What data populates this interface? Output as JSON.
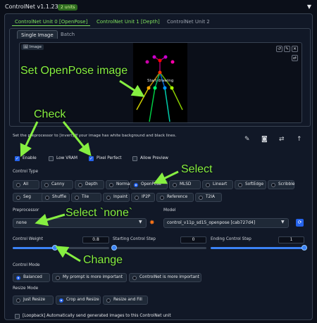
{
  "header": {
    "title": "ControlNet v1.1.233",
    "badge": "2 units",
    "collapse_icon": "triangle-down-icon"
  },
  "units_tabs": [
    "ControlNet Unit 0 [OpenPose]",
    "ControlNet Unit 1 [Depth]",
    "ControlNet Unit 2"
  ],
  "sub_tabs": [
    "Single Image",
    "Batch"
  ],
  "image": {
    "label": "Image",
    "overlay_text": "Start drawing"
  },
  "annotations": {
    "set_image": "Set OpenPose image",
    "check": "Check",
    "select": "Select",
    "select_none": "Select `none`",
    "change": "Change"
  },
  "hint": "Set the preprocessor to [invert] If your image has white background and black lines.",
  "checkboxes": [
    {
      "label": "Enable",
      "checked": true
    },
    {
      "label": "Low VRAM",
      "checked": false
    },
    {
      "label": "Pixel Perfect",
      "checked": true
    },
    {
      "label": "Allow Preview",
      "checked": false
    }
  ],
  "control_type": {
    "label": "Control Type",
    "row1": [
      "All",
      "Canny",
      "Depth",
      "Normal",
      "OpenPose",
      "MLSD",
      "Lineart",
      "SoftEdge",
      "Scribble"
    ],
    "row2": [
      "Seg",
      "Shuffle",
      "Tile",
      "Inpaint",
      "IP2P",
      "Reference",
      "T2IA"
    ],
    "selected": "OpenPose"
  },
  "preprocessor": {
    "label": "Preprocessor",
    "value": "none"
  },
  "model": {
    "label": "Model",
    "value": "control_v11p_sd15_openpose [cab727d4]"
  },
  "sliders": {
    "weight": {
      "label": "Control Weight",
      "value": "0.8"
    },
    "start": {
      "label": "Starting Control Step",
      "value": "0"
    },
    "end": {
      "label": "Ending Control Step",
      "value": "1"
    }
  },
  "control_mode": {
    "label": "Control Mode",
    "options": [
      "Balanced",
      "My prompt is more important",
      "ControlNet is more important"
    ],
    "selected": "Balanced"
  },
  "resize_mode": {
    "label": "Resize Mode",
    "options": [
      "Just Resize",
      "Crop and Resize",
      "Resize and Fill"
    ],
    "selected": "Crop and Resize"
  },
  "loopback": "[Loopback] Automatically send generated images to this ControlNet unit",
  "colors": {
    "accent": "#2563eb",
    "annotation": "#86ef41",
    "tab_active": "#7ee05c"
  }
}
